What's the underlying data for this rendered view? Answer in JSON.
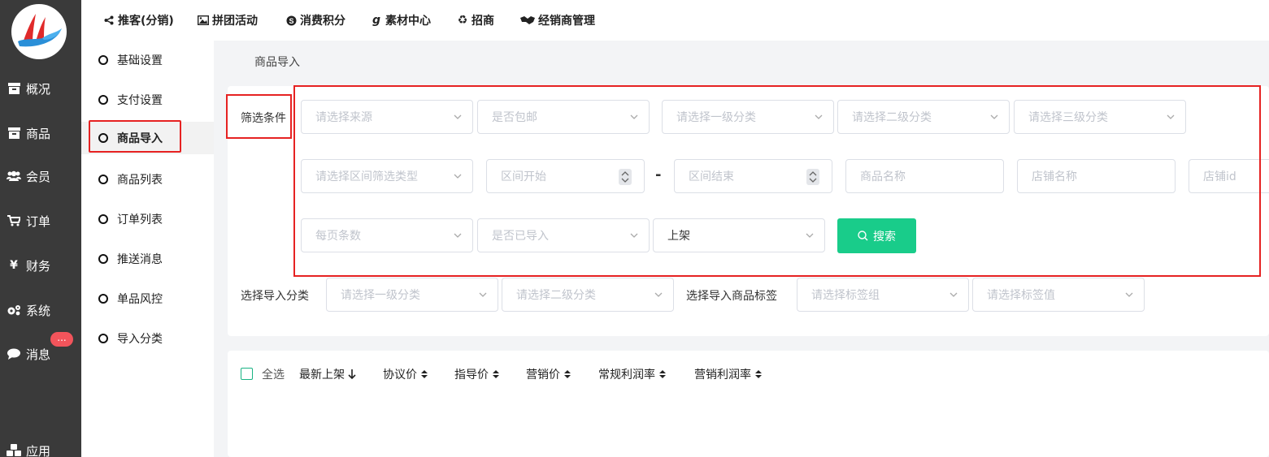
{
  "sidebar": {
    "items": [
      {
        "label": "概况",
        "icon": "archive-icon"
      },
      {
        "label": "商品",
        "icon": "box-icon"
      },
      {
        "label": "会员",
        "icon": "users-icon"
      },
      {
        "label": "订单",
        "icon": "cart-icon"
      },
      {
        "label": "财务",
        "icon": "yen-icon"
      },
      {
        "label": "系统",
        "icon": "gears-icon"
      },
      {
        "label": "消息",
        "icon": "chat-icon"
      },
      {
        "label": "应用",
        "icon": "apps-icon"
      }
    ],
    "message_badge": "..."
  },
  "topnav": {
    "items": [
      {
        "label": "推客(分销)",
        "icon": "share-icon"
      },
      {
        "label": "拼团活动",
        "icon": "image-icon"
      },
      {
        "label": "消费积分",
        "icon": "skype-icon"
      },
      {
        "label": "素材中心",
        "icon": "gplus-icon"
      },
      {
        "label": "招商",
        "icon": "recycle-icon"
      },
      {
        "label": "经销商管理",
        "icon": "handshake-icon"
      }
    ]
  },
  "submenu": {
    "items": [
      "基础设置",
      "支付设置",
      "商品导入",
      "商品列表",
      "订单列表",
      "推送消息",
      "单品风控",
      "导入分类"
    ],
    "active": "商品导入"
  },
  "breadcrumb": "商品导入",
  "filters": {
    "label": "筛选条件",
    "source_placeholder": "请选择来源",
    "free_shipping_placeholder": "是否包邮",
    "category1_placeholder": "请选择一级分类",
    "category2_placeholder": "请选择二级分类",
    "category3_placeholder": "请选择三级分类",
    "range_type_placeholder": "请选择区间筛选类型",
    "range_start_placeholder": "区间开始",
    "range_end_placeholder": "区间结束",
    "range_dash": "-",
    "product_name_placeholder": "商品名称",
    "shop_name_placeholder": "店铺名称",
    "shop_id_placeholder": "店铺id",
    "page_size_placeholder": "每页条数",
    "imported_placeholder": "是否已导入",
    "shelf_status_value": "上架",
    "search_label": "搜索"
  },
  "import_options": {
    "category_label": "选择导入分类",
    "category1_placeholder": "请选择一级分类",
    "category2_placeholder": "请选择二级分类",
    "tag_label": "选择导入商品标签",
    "tag_group_placeholder": "请选择标签组",
    "tag_value_placeholder": "请选择标签值"
  },
  "list_header": {
    "select_all": "全选",
    "sort_columns": [
      "最新上架",
      "协议价",
      "指导价",
      "营销价",
      "常规利润率",
      "营销利润率"
    ]
  },
  "colors": {
    "sidebar_bg": "#3a3a3a",
    "accent": "#19cc8a",
    "highlight_box": "#e62222",
    "badge": "#f2545b"
  }
}
